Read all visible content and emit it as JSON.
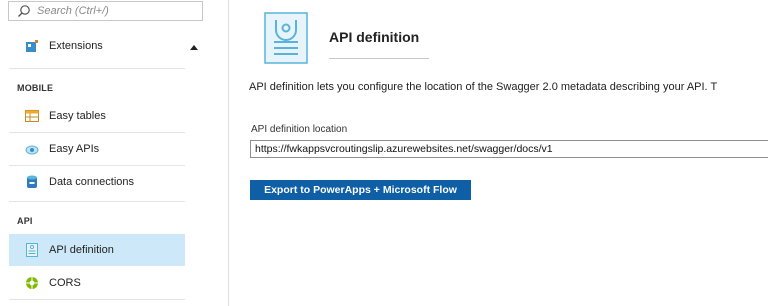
{
  "search": {
    "placeholder": "Search (Ctrl+/)"
  },
  "sidebar": {
    "items_top": [
      {
        "label": "Extensions",
        "icon": "extensions-icon"
      }
    ],
    "sections": [
      {
        "title": "MOBILE",
        "items": [
          {
            "label": "Easy tables",
            "icon": "table-icon"
          },
          {
            "label": "Easy APIs",
            "icon": "cloud-api-icon"
          },
          {
            "label": "Data connections",
            "icon": "database-icon"
          }
        ]
      },
      {
        "title": "API",
        "items": [
          {
            "label": "API definition",
            "icon": "api-definition-icon",
            "active": true
          },
          {
            "label": "CORS",
            "icon": "cors-icon"
          }
        ]
      }
    ]
  },
  "main": {
    "title": "API definition",
    "description": "API definition lets you configure the location of the Swagger 2.0 metadata describing your API. T",
    "field_label": "API definition location",
    "field_value": "https://fwkappsvcroutingslip.azurewebsites.net/swagger/docs/v1",
    "export_button": "Export to PowerApps + Microsoft Flow"
  },
  "colors": {
    "accent": "#0e5fa6",
    "active_bg": "#cde8f8",
    "icon_blue": "#59b4d9"
  }
}
